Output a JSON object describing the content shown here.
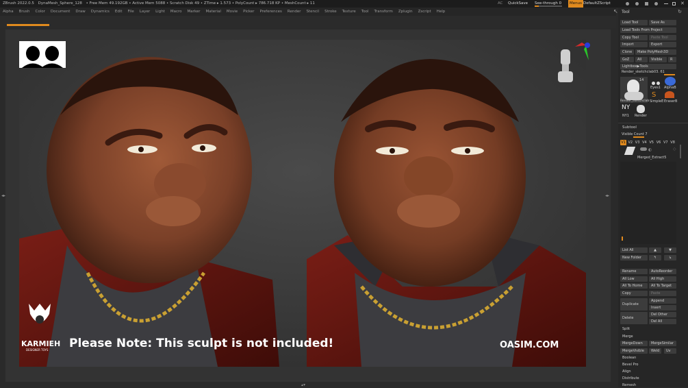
{
  "titlebar": {
    "app": "ZBrush 2022.0.5",
    "doc": "DynaMesh_Sphere_128",
    "stats": "• Free Mem 49.192GB • Active Mem 5088 • Scratch Disk 49 • ZTime ▸ 1.573 • PolyCount ▸ 786.718 KP • MeshCount ▸ 11",
    "ac": "AC",
    "quicksave": "QuickSave",
    "seethrough": "See-through  0",
    "menus": "Menus",
    "zscript": "DefaultZScript"
  },
  "menu": [
    "Alpha",
    "Brush",
    "Color",
    "Document",
    "Draw",
    "Dynamics",
    "Edit",
    "File",
    "Layer",
    "Light",
    "Macro",
    "Marker",
    "Material",
    "Movie",
    "Picker",
    "Preferences",
    "Render",
    "Stencil",
    "Stroke",
    "Texture",
    "Tool",
    "Transform",
    "Zplugin",
    "Zscript",
    "Help"
  ],
  "viewport": {
    "caption": "Please Note: This sculpt is not included!",
    "site": "OASIM.COM",
    "brand": "KARMIEH",
    "brand_sub": "DESIGNER TOYS"
  },
  "panel": {
    "title": "Tool",
    "load_tool": "Load Tool",
    "save_as": "Save As",
    "load_from_project": "Load Tools From Project",
    "copy_tool": "Copy Tool",
    "paste_tool": "Paste Tool",
    "import": "Import",
    "export": "Export",
    "clone": "Clone",
    "make_polymesh": "Make PolyMesh3D",
    "goz": "GoZ",
    "all": "All",
    "visible": "Visible",
    "r": "R",
    "lightbox_tools": "Lightbox▶Tools",
    "render_name": "Render_sketchclab03. 61",
    "thumb_count": "14",
    "thumb_label": "Render_sketchclab",
    "eyes1": "Eyes1",
    "alphab": "AlphaB",
    "simple": "SimpleE",
    "eraser": "EraserB",
    "ny1": "NY1",
    "render": "Render",
    "subtool": "Subtool",
    "visible_count": "Visible Count  7",
    "versions": [
      "V1",
      "V2",
      "V3",
      "V4",
      "V5",
      "V6",
      "V7",
      "V8"
    ],
    "merged": "Merged_Extract5",
    "list_all": "List All",
    "new_folder": "New Folder",
    "rename": "Rename",
    "autoreorder": "AutoReorder",
    "all_low": "All Low",
    "all_high": "All High",
    "all_to_home": "All To Home",
    "all_to_target": "All To Target",
    "copy": "Copy",
    "paste": "Paste",
    "duplicate": "Duplicate",
    "append": "Append",
    "insert": "Insert",
    "delete": "Delete",
    "del_other": "Del Other",
    "del_all": "Del All",
    "split": "Split",
    "merge": "Merge",
    "mergedown": "MergeDown",
    "mergesimilar": "MergeSimilar",
    "mergevisible": "MergeVisible",
    "weld": "Weld",
    "uv": "Uv",
    "boolean": "Boolean",
    "bevel_pro": "Bevel Pro",
    "align": "Align",
    "distribute": "Distribute",
    "remesh": "Remesh"
  },
  "colors": {
    "accent": "#e08a1e",
    "skin": "#7a4028",
    "jacket": "#6a1812",
    "shirt": "#3a3a3e",
    "gold": "#c9a032"
  }
}
